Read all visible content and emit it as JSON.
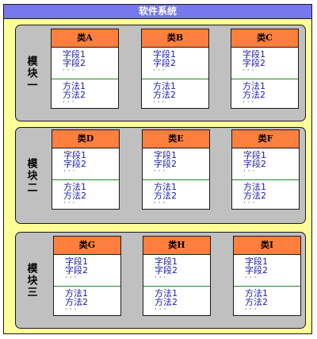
{
  "system": {
    "title": "软件系统"
  },
  "modules": [
    {
      "label": "模块一",
      "classes": [
        {
          "name": "类A",
          "fields": [
            "字段1",
            "字段2",
            "· · ·"
          ],
          "methods": [
            "方法1",
            "方法2",
            "· · ·"
          ]
        },
        {
          "name": "类B",
          "fields": [
            "字段1",
            "字段2",
            "· · ·"
          ],
          "methods": [
            "方法1",
            "方法2",
            "· · ·"
          ]
        },
        {
          "name": "类C",
          "fields": [
            "字段1",
            "字段2",
            "· · ·"
          ],
          "methods": [
            "方法1",
            "方法2",
            "· · ·"
          ]
        }
      ]
    },
    {
      "label": "模块二",
      "classes": [
        {
          "name": "类D",
          "fields": [
            "字段1",
            "字段2",
            "· · ·"
          ],
          "methods": [
            "方法1",
            "方法2",
            "· · ·"
          ]
        },
        {
          "name": "类E",
          "fields": [
            "字段1",
            "字段2",
            "· · ·"
          ],
          "methods": [
            "方法1",
            "方法2",
            "· · ·"
          ]
        },
        {
          "name": "类F",
          "fields": [
            "字段1",
            "字段2",
            "· · ·"
          ],
          "methods": [
            "方法1",
            "方法2",
            "· · ·"
          ]
        }
      ]
    },
    {
      "label": "模块三",
      "classes": [
        {
          "name": "类G",
          "fields": [
            "字段1",
            "字段2",
            "· · ·"
          ],
          "methods": [
            "方法1",
            "方法2",
            "· · ·"
          ]
        },
        {
          "name": "类H",
          "fields": [
            "字段1",
            "字段2",
            "· · ·"
          ],
          "methods": [
            "方法1",
            "方法2",
            "· · ·"
          ]
        },
        {
          "name": "类I",
          "fields": [
            "字段1",
            "字段2",
            "· · ·"
          ],
          "methods": [
            "方法1",
            "方法2",
            "· · ·"
          ]
        }
      ]
    }
  ],
  "colors": {
    "system_background": "#ffff99",
    "title_bar": "#7777ee",
    "module_background": "#c0c0c0",
    "class_header": "#ff7f3f",
    "member_text": "#1a1aaa",
    "section_divider": "#228822"
  }
}
